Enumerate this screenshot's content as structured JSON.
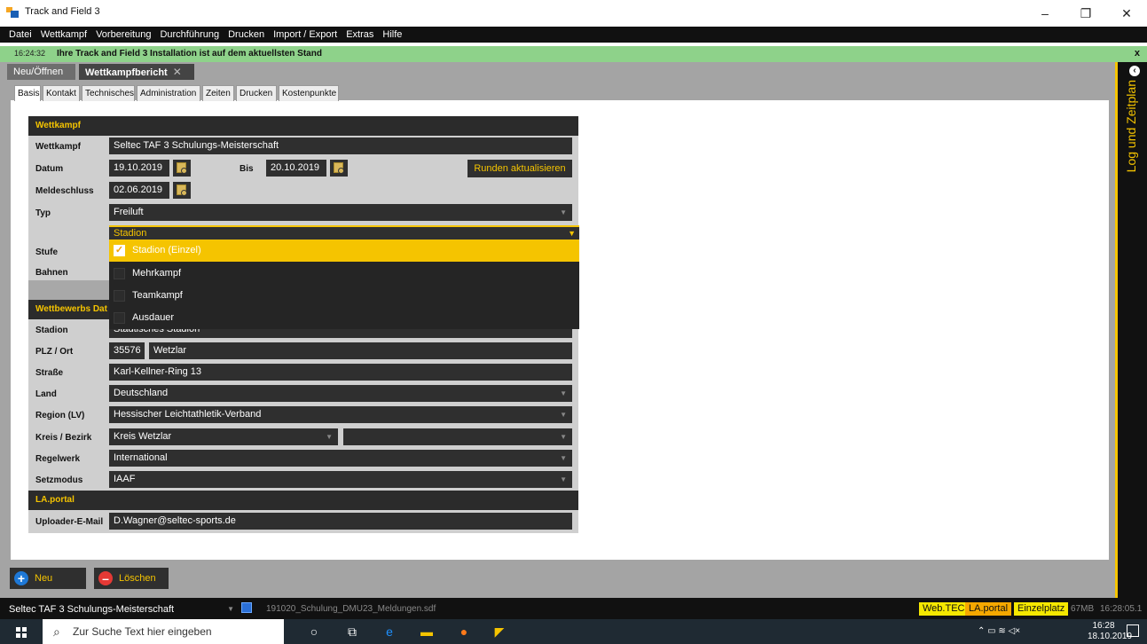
{
  "window": {
    "title": "Track and Field 3",
    "minimize": "–",
    "maximize": "❐",
    "close": "✕"
  },
  "menu": [
    "Datei",
    "Wettkampf",
    "Vorbereitung",
    "Durchführung",
    "Drucken",
    "Import / Export",
    "Extras",
    "Hilfe"
  ],
  "notification": {
    "time": "16:24:32",
    "message": "Ihre Track and Field 3 Installation ist auf dem aktuellsten Stand",
    "close": "x"
  },
  "doc_tabs": [
    {
      "label": "Neu/Öffnen"
    },
    {
      "label": "Wettkampfbericht",
      "close": "✕"
    }
  ],
  "sub_tabs": [
    "Basis",
    "Kontakt",
    "Technisches",
    "Administration",
    "Zeiten",
    "Drucken",
    "Kostenpunkte"
  ],
  "sections": {
    "wettkampf": "Wettkampf",
    "wettbewerbs": "Wettbewerbs Dat",
    "laportal": "LA.portal"
  },
  "labels": {
    "wettkampf": "Wettkampf",
    "datum": "Datum",
    "bis": "Bis",
    "meldeschluss": "Meldeschluss",
    "typ": "Typ",
    "stufe": "Stufe",
    "bahnen": "Bahnen",
    "stadion": "Stadion",
    "plz_ort": "PLZ / Ort",
    "strasse": "Straße",
    "land": "Land",
    "region": "Region (LV)",
    "kreis": "Kreis / Bezirk",
    "regelwerk": "Regelwerk",
    "setzmodus": "Setzmodus",
    "uploader": "Uploader-E-Mail"
  },
  "values": {
    "wettkampf": "Seltec TAF 3 Schulungs-Meisterschaft",
    "datum": "19.10.2019",
    "bis": "20.10.2019",
    "meldeschluss": "02.06.2019",
    "typ": "Freiluft",
    "typ2": "Stadion",
    "stadion": "Städtisches Stadion",
    "plz": "35576",
    "ort": "Wetzlar",
    "strasse": "Karl-Kellner-Ring 13",
    "land": "Deutschland",
    "region": "Hessischer Leichtathletik-Verband",
    "kreis": "Kreis Wetzlar",
    "bezirk": "",
    "regelwerk": "International",
    "setzmodus": "IAAF",
    "uploader": "D.Wagner@seltec-sports.de"
  },
  "buttons": {
    "runden": "Runden aktualisieren",
    "neu": "Neu",
    "loeschen": "Löschen"
  },
  "dropdown_options": [
    {
      "label": "Stadion (Einzel)",
      "checked": true
    },
    {
      "label": "Mehrkampf",
      "checked": false
    },
    {
      "label": "Teamkampf",
      "checked": false
    },
    {
      "label": "Ausdauer",
      "checked": false
    }
  ],
  "right_panel": {
    "label": "Log und Zeitplan",
    "collapse": "‹"
  },
  "status": {
    "competition": "Seltec TAF 3 Schulungs-Meisterschaft",
    "file": "191020_Schulung_DMU23_Meldungen.sdf",
    "badges": [
      "Web.TEC",
      "LA.portal",
      "Einzelplatz"
    ],
    "memory": "67MB",
    "clock": "16:28:05.1"
  },
  "taskbar": {
    "search_placeholder": "Zur Suche Text hier eingeben",
    "time": "16:28",
    "date": "18.10.2019"
  },
  "colors": {
    "accent": "#f5c400",
    "dark": "#2f2f2f",
    "notify": "#8ed28a"
  }
}
